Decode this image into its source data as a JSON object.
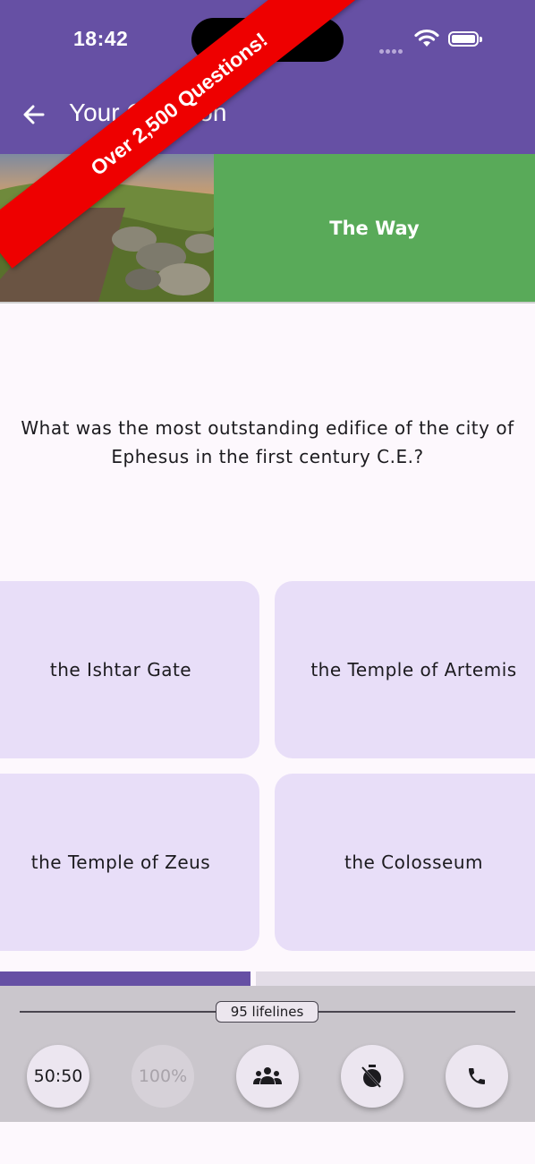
{
  "status": {
    "time": "18:42"
  },
  "appbar": {
    "title": "Your Question"
  },
  "banner": {
    "text": "Over 2,500 Questions!"
  },
  "category": {
    "label": "The Way"
  },
  "question": {
    "text": "What was the most outstanding edifice of the city of Ephesus in the first century C.E.?"
  },
  "answers": [
    {
      "label": "the Ishtar Gate"
    },
    {
      "label": "the Temple of Artemis"
    },
    {
      "label": "the Temple of Zeus"
    },
    {
      "label": "the Colosseum"
    }
  ],
  "progress": {
    "fraction": 0.47
  },
  "lifelines": {
    "count_label": "95 lifelines",
    "fifty_fifty": "50:50",
    "hundred_percent": "100%",
    "icons": [
      "audience-icon",
      "timer-off-icon",
      "phone-icon"
    ]
  },
  "colors": {
    "accent": "#6650a4",
    "category": "#59aa59",
    "banner": "#ee0000",
    "answer_bg": "#e8def8"
  }
}
